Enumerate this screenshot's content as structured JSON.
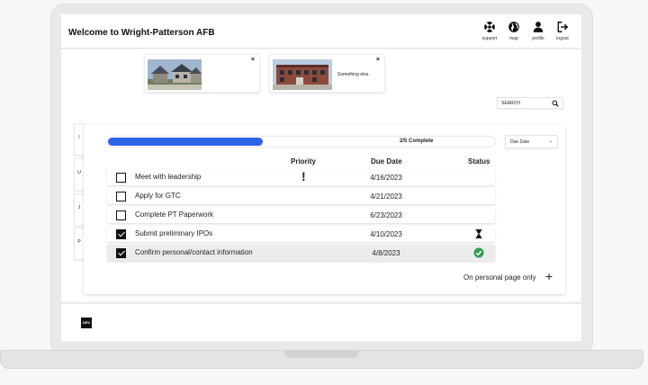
{
  "header": {
    "title": "Welcome to Wright-Patterson AFB",
    "nav": [
      {
        "label": "support",
        "icon": "support-icon"
      },
      {
        "label": "map",
        "icon": "globe-icon"
      },
      {
        "label": "profile",
        "icon": "person-icon"
      },
      {
        "label": "logout",
        "icon": "logout-icon"
      }
    ]
  },
  "cards": [
    {
      "caption": "",
      "close": "×",
      "image": "houses-photo"
    },
    {
      "caption": "Something else.",
      "close": "×",
      "image": "brick-building-photo"
    }
  ],
  "search": {
    "placeholder": "SEARCH",
    "icon": "search-icon"
  },
  "sort": {
    "value": "Due Date",
    "icon": "chevron-down-icon"
  },
  "side_tabs": [
    "I",
    "U",
    "J",
    "P"
  ],
  "progress": {
    "label": "2/5 Complete",
    "completed": 2,
    "total": 5
  },
  "table": {
    "headers": {
      "priority": "Priority",
      "due": "Due Date",
      "status": "Status"
    },
    "rows": [
      {
        "task": "Meet with leadership",
        "due": "4/16/2023",
        "checked": false,
        "priority": "!",
        "status": ""
      },
      {
        "task": "Apply for GTC",
        "due": "4/21/2023",
        "checked": false,
        "priority": "",
        "status": ""
      },
      {
        "task": "Complete PT Paperwork",
        "due": "6/23/2023",
        "checked": false,
        "priority": "",
        "status": ""
      },
      {
        "task": "Submit preliminary IPOs",
        "due": "4/10/2023",
        "checked": true,
        "priority": "",
        "status": "hourglass-icon"
      },
      {
        "task": "Confirm personal/contact information",
        "due": "4/8/2023",
        "checked": true,
        "priority": "",
        "status": "check-circle-icon"
      }
    ]
  },
  "add": {
    "label": "On personal page only",
    "button": "+"
  },
  "footer": {
    "badge": "DEV"
  },
  "colors": {
    "accent": "#2d63e6",
    "success": "#2e9e4f"
  }
}
